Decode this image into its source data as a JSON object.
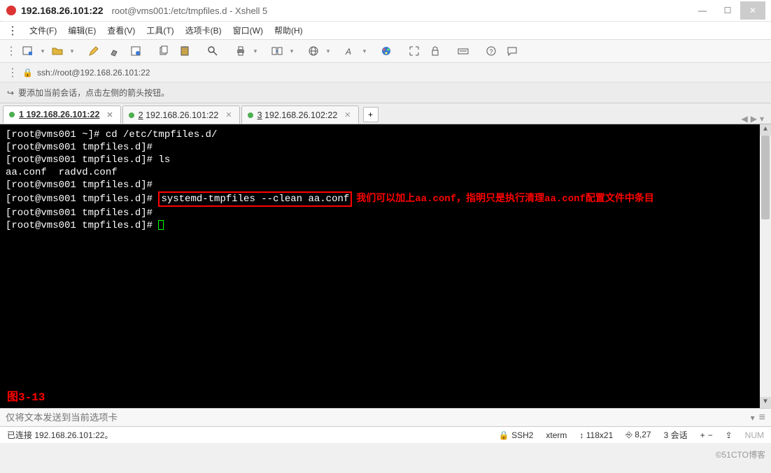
{
  "window": {
    "ip_title": "192.168.26.101:22",
    "subtitle": "root@vms001:/etc/tmpfiles.d - Xshell 5"
  },
  "menu": {
    "items": [
      "文件(F)",
      "编辑(E)",
      "查看(V)",
      "工具(T)",
      "选项卡(B)",
      "窗口(W)",
      "帮助(H)"
    ]
  },
  "toolbar_icons": [
    "new-session-icon",
    "open-icon",
    "sep",
    "pen-icon",
    "brush-icon",
    "properties-icon",
    "sep",
    "copy-icon",
    "paste-icon",
    "sep",
    "search-icon",
    "sep",
    "print-icon",
    "sep",
    "reconnect-icon",
    "sep",
    "globe-icon",
    "sep",
    "font-icon",
    "sep",
    "color-palette-icon",
    "sep",
    "expand-icon",
    "lock-icon",
    "sep",
    "keyboard-icon",
    "sep",
    "help-icon",
    "chat-icon"
  ],
  "address": {
    "url": "ssh://root@192.168.26.101:22"
  },
  "infobar": {
    "text": "要添加当前会话，点击左侧的箭头按钮。"
  },
  "tabs": {
    "items": [
      {
        "num": "1",
        "label": "192.168.26.101:22",
        "active": true
      },
      {
        "num": "2",
        "label": "192.168.26.101:22",
        "active": false
      },
      {
        "num": "3",
        "label": "192.168.26.102:22",
        "active": false
      }
    ]
  },
  "terminal": {
    "lines": [
      {
        "prompt": "[root@vms001 ~]# ",
        "cmd": "cd /etc/tmpfiles.d/"
      },
      {
        "prompt": "[root@vms001 tmpfiles.d]#",
        "cmd": ""
      },
      {
        "prompt": "[root@vms001 tmpfiles.d]# ",
        "cmd": "ls"
      },
      {
        "prompt": "",
        "cmd": "aa.conf  radvd.conf"
      },
      {
        "prompt": "[root@vms001 tmpfiles.d]#",
        "cmd": ""
      },
      {
        "prompt": "[root@vms001 tmpfiles.d]# ",
        "highlight": "systemd-tmpfiles --clean aa.conf",
        "note": "我们可以加上aa.conf，指明只是执行清理aa.conf配置文件中条目"
      },
      {
        "prompt": "[root@vms001 tmpfiles.d]#",
        "cmd": ""
      },
      {
        "prompt": "[root@vms001 tmpfiles.d]# ",
        "cursor": true
      }
    ],
    "figure_label": "图3-13"
  },
  "sendbar": {
    "placeholder": "仅将文本发送到当前选项卡"
  },
  "status": {
    "connected": "已连接 192.168.26.101:22。",
    "proto": "SSH2",
    "term": "xterm",
    "size": "118x21",
    "pos": "8,27",
    "sessions": "3 会话"
  },
  "watermark": "©51CTO博客",
  "glyphs": {
    "lock": "🔒",
    "arrow": "↪",
    "plus": "+",
    "left": "◀",
    "right": "▶",
    "down": "▾",
    "menu": "≡",
    "updown": "↕",
    "caps": "⇪"
  }
}
